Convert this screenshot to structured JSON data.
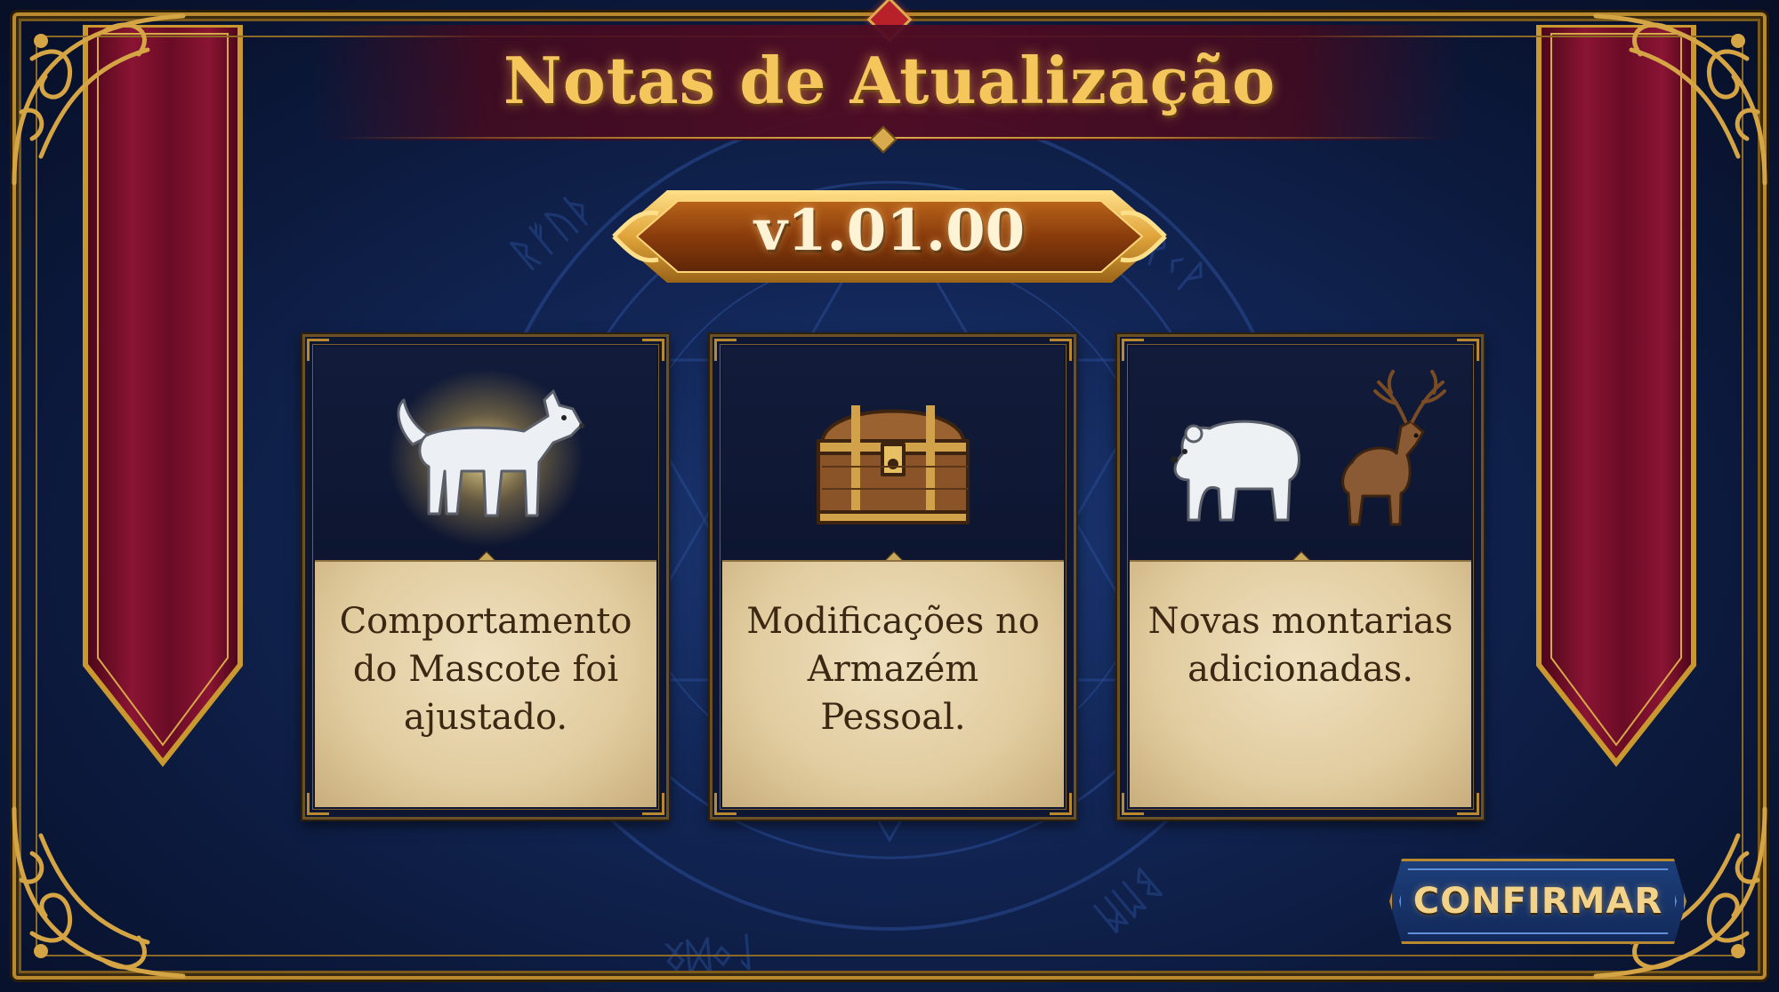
{
  "title": "Notas de Atualização",
  "version": "v1.01.00",
  "cards": [
    {
      "text": "Comportamento do Mascote foi ajustado.",
      "icon": "dog-icon"
    },
    {
      "text": "Modificações no Armazém Pessoal.",
      "icon": "treasure-chest-icon"
    },
    {
      "text": "Novas montarias adicionadas.",
      "icon": "bear-and-deer-icon"
    }
  ],
  "confirm_label": "CONFIRMAR",
  "colors": {
    "background": "#0c1a3e",
    "gold": "#b8892e",
    "title_gold": "#f4c65c",
    "banner_red": "#7a0f2c",
    "parchment": "#e1cc9f",
    "button_blue": "#1d3f7a"
  }
}
